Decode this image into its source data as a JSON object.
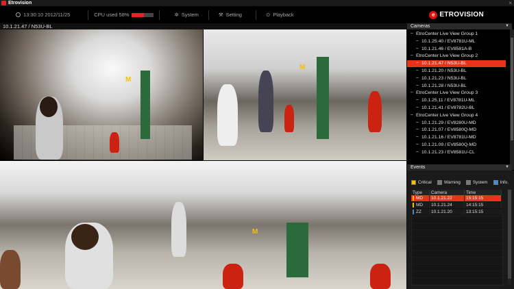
{
  "window": {
    "title": "Etrovision"
  },
  "toolbar": {
    "datetime": "13:30:10 2012/11/25",
    "cpu_label": "CPU used 58%",
    "cpu_percent": 58,
    "system_label": "System",
    "setting_label": "Setting",
    "playback_label": "Playback",
    "logo_text": "ETROVISION"
  },
  "video": {
    "header": "10.1.21.47 / N53U-BL",
    "panes": [
      "pane-fisheye",
      "pane-dewarp-1",
      "pane-panorama"
    ],
    "signs": {
      "m": "M"
    }
  },
  "cameras": {
    "title": "Cameras",
    "items": [
      {
        "label": "EtroCenter Live View Group 1",
        "level": 0,
        "selected": false
      },
      {
        "label": "10.1.25.40 / EV8781U-ML",
        "level": 1,
        "selected": false
      },
      {
        "label": "10.1.21.46 / EV8581A-B",
        "level": 1,
        "selected": false
      },
      {
        "label": "EtroCenter Live View Group 2",
        "level": 0,
        "selected": false
      },
      {
        "label": "10.1.21.47 / N53U-BL",
        "level": 1,
        "selected": true
      },
      {
        "label": "10.1.21.20 / N53U-BL",
        "level": 1,
        "selected": false
      },
      {
        "label": "10.1.21.23 / N53U-BL",
        "level": 1,
        "selected": false
      },
      {
        "label": "10.1.21.28 / N53U-BL",
        "level": 1,
        "selected": false
      },
      {
        "label": "EtroCenter Live View Group 3",
        "level": 0,
        "selected": false
      },
      {
        "label": "10.1.25.11 / EV8781U-ML",
        "level": 1,
        "selected": false
      },
      {
        "label": "10.1.21.41 / EV8782U-BL",
        "level": 1,
        "selected": false
      },
      {
        "label": "EtroCenter Live View Group 4",
        "level": 0,
        "selected": false
      },
      {
        "label": "10.1.21.29 / EV8280U-MD",
        "level": 1,
        "selected": false
      },
      {
        "label": "10.1.21.07 / EV8580Q-MD",
        "level": 1,
        "selected": false
      },
      {
        "label": "10.1.21.16 / EV8781U-MD",
        "level": 1,
        "selected": false
      },
      {
        "label": "10.1.21.09 / EV8580Q-MD",
        "level": 1,
        "selected": false
      },
      {
        "label": "10.1.21.23 / EV8581U-CL",
        "level": 1,
        "selected": false
      }
    ]
  },
  "events": {
    "title": "Events",
    "filters": [
      {
        "label": "Critical",
        "color": "#f2c200"
      },
      {
        "label": "Warning",
        "color": "#777777"
      },
      {
        "label": "System",
        "color": "#777777"
      },
      {
        "label": "Info.",
        "color": "#3a8fd9"
      }
    ],
    "columns": [
      "Type",
      "Camera",
      "Time"
    ],
    "rows": [
      {
        "type": "MD",
        "camera": "10.1.21.22",
        "time": "15:15:15",
        "color": "#f2c200",
        "selected": true
      },
      {
        "type": "MD",
        "camera": "10.1.21.24",
        "time": "14:15:15",
        "color": "#f2c200",
        "selected": false
      },
      {
        "type": "ZZ",
        "camera": "10.1.21.20",
        "time": "13:15:15",
        "color": "#3a8fd9",
        "selected": false
      }
    ]
  },
  "colors": {
    "accent": "#e8321c",
    "background": "#000000"
  }
}
